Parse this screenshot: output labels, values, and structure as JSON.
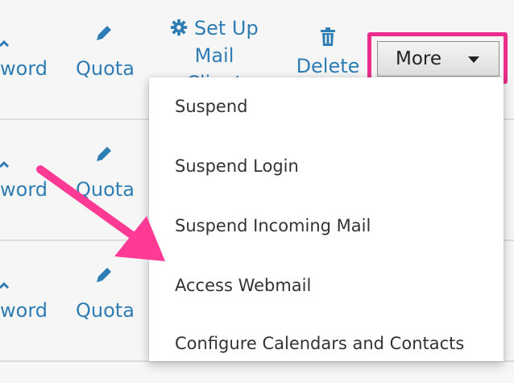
{
  "rows": [
    {
      "password_label": "word",
      "quota_label": "Quota"
    },
    {
      "password_label": "word",
      "quota_label": "Quota"
    },
    {
      "password_label": "word",
      "quota_label": "Quota"
    }
  ],
  "toolbar": {
    "setup_line1": "Set Up",
    "setup_line2": "Mail",
    "setup_line3": "Client",
    "delete_label": "Delete",
    "more_label": "More"
  },
  "menu": {
    "items": [
      "Suspend",
      "Suspend Login",
      "Suspend Incoming Mail",
      "Access Webmail",
      "Configure Calendars and Contacts"
    ]
  },
  "colors": {
    "link": "#2e7db5",
    "highlight": "#ea2e8e",
    "arrow": "#ff3a95"
  },
  "icons": [
    "pencil-icon",
    "gear-icon",
    "trash-icon",
    "caret-down-icon",
    "up-arrow-icon"
  ]
}
